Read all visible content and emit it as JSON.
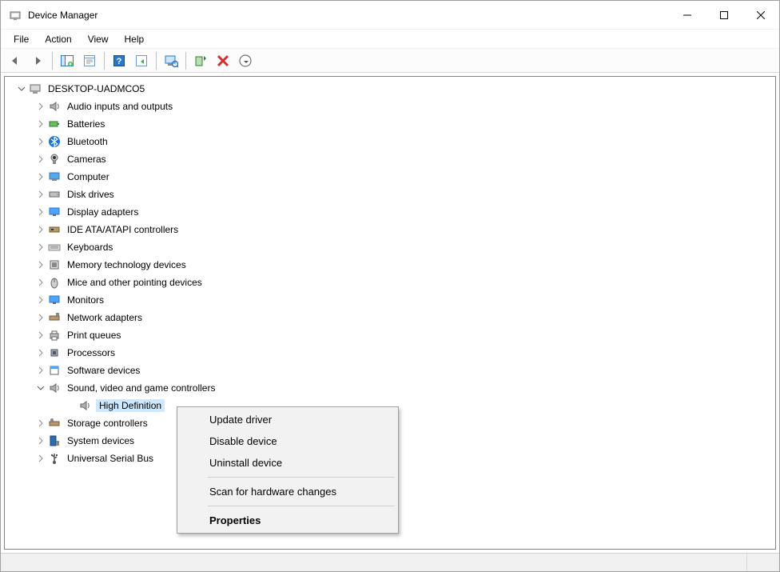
{
  "window": {
    "title": "Device Manager"
  },
  "menubar": {
    "items": [
      "File",
      "Action",
      "View",
      "Help"
    ]
  },
  "toolbar": {
    "buttons": [
      {
        "name": "back-icon"
      },
      {
        "name": "forward-icon"
      },
      {
        "sep": true
      },
      {
        "name": "show-hide-icon"
      },
      {
        "name": "help-window-icon"
      },
      {
        "sep": true
      },
      {
        "name": "help-icon"
      },
      {
        "name": "refresh-icon"
      },
      {
        "sep": true
      },
      {
        "name": "scan-hw-icon"
      },
      {
        "sep": true
      },
      {
        "name": "enable-icon"
      },
      {
        "name": "delete-icon"
      },
      {
        "name": "properties-icon"
      }
    ]
  },
  "tree": {
    "root": {
      "label": "DESKTOP-UADMCO5",
      "icon": "computer-icon",
      "expanded": true,
      "children": [
        {
          "label": "Audio inputs and outputs",
          "icon": "speaker-icon",
          "expandable": true
        },
        {
          "label": "Batteries",
          "icon": "battery-icon",
          "expandable": true
        },
        {
          "label": "Bluetooth",
          "icon": "bluetooth-icon",
          "expandable": true
        },
        {
          "label": "Cameras",
          "icon": "camera-icon",
          "expandable": true
        },
        {
          "label": "Computer",
          "icon": "pc-icon",
          "expandable": true
        },
        {
          "label": "Disk drives",
          "icon": "disk-icon",
          "expandable": true
        },
        {
          "label": "Display adapters",
          "icon": "display-icon",
          "expandable": true
        },
        {
          "label": "IDE ATA/ATAPI controllers",
          "icon": "ide-icon",
          "expandable": true
        },
        {
          "label": "Keyboards",
          "icon": "keyboard-icon",
          "expandable": true
        },
        {
          "label": "Memory technology devices",
          "icon": "memory-icon",
          "expandable": true
        },
        {
          "label": "Mice and other pointing devices",
          "icon": "mouse-icon",
          "expandable": true
        },
        {
          "label": "Monitors",
          "icon": "monitor-icon",
          "expandable": true
        },
        {
          "label": "Network adapters",
          "icon": "network-icon",
          "expandable": true
        },
        {
          "label": "Print queues",
          "icon": "printer-icon",
          "expandable": true
        },
        {
          "label": "Processors",
          "icon": "cpu-icon",
          "expandable": true
        },
        {
          "label": "Software devices",
          "icon": "software-icon",
          "expandable": true
        },
        {
          "label": "Sound, video and game controllers",
          "icon": "speaker-icon",
          "expandable": true,
          "expanded": true,
          "children": [
            {
              "label": "High Definition",
              "icon": "speaker-icon",
              "selected": true
            }
          ]
        },
        {
          "label": "Storage controllers",
          "icon": "storage-icon",
          "expandable": true
        },
        {
          "label": "System devices",
          "icon": "system-icon",
          "expandable": true
        },
        {
          "label": "Universal Serial Bus",
          "icon": "usb-icon",
          "expandable": true
        }
      ]
    }
  },
  "context_menu": {
    "items": [
      {
        "label": "Update driver"
      },
      {
        "label": "Disable device"
      },
      {
        "label": "Uninstall device"
      },
      {
        "sep": true
      },
      {
        "label": "Scan for hardware changes"
      },
      {
        "sep": true
      },
      {
        "label": "Properties",
        "bold": true
      }
    ]
  }
}
